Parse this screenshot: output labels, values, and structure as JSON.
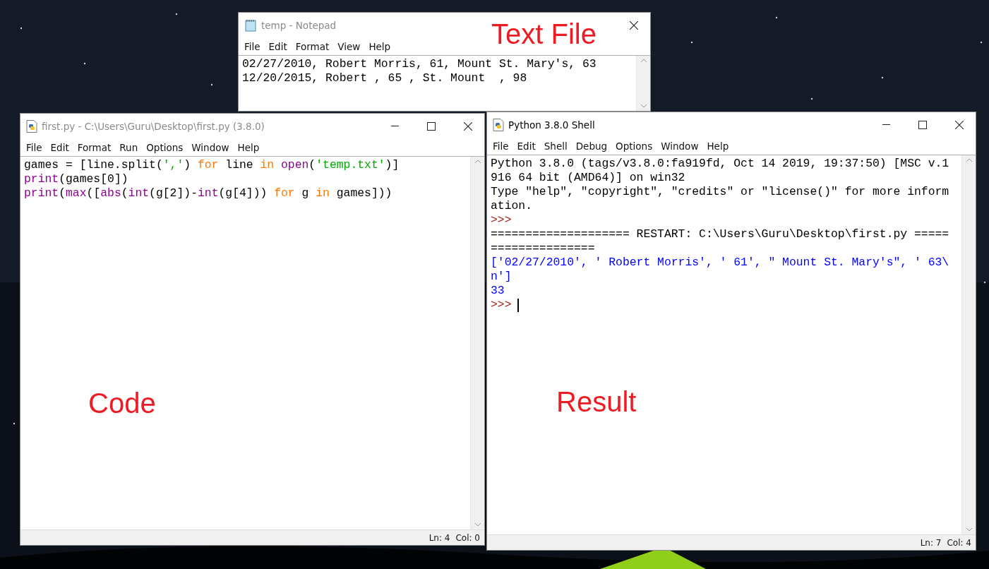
{
  "notepad": {
    "title": "temp - Notepad",
    "menu": [
      "File",
      "Edit",
      "Format",
      "View",
      "Help"
    ],
    "lines": [
      "02/27/2010, Robert Morris, 61, Mount St. Mary's, 63",
      "12/20/2015, Robert , 65 , St. Mount  , 98"
    ],
    "annotation": "Text File"
  },
  "editor": {
    "title": "first.py - C:\\Users\\Guru\\Desktop\\first.py (3.8.0)",
    "menu": [
      "File",
      "Edit",
      "Format",
      "Run",
      "Options",
      "Window",
      "Help"
    ],
    "lines": [
      [
        {
          "kind": "plain",
          "text": "games = [line.split("
        },
        {
          "kind": "string",
          "text": "','"
        },
        {
          "kind": "plain",
          "text": ") "
        },
        {
          "kind": "keyword",
          "text": "for"
        },
        {
          "kind": "plain",
          "text": " line "
        },
        {
          "kind": "keyword",
          "text": "in "
        },
        {
          "kind": "builtin",
          "text": "open"
        },
        {
          "kind": "plain",
          "text": "("
        },
        {
          "kind": "string",
          "text": "'temp.txt'"
        },
        {
          "kind": "plain",
          "text": ")]"
        }
      ],
      [
        {
          "kind": "builtin",
          "text": "print"
        },
        {
          "kind": "plain",
          "text": "(games[0])"
        }
      ],
      [
        {
          "kind": "builtin",
          "text": "print"
        },
        {
          "kind": "plain",
          "text": "("
        },
        {
          "kind": "builtin",
          "text": "max"
        },
        {
          "kind": "plain",
          "text": "(["
        },
        {
          "kind": "builtin",
          "text": "abs"
        },
        {
          "kind": "plain",
          "text": "("
        },
        {
          "kind": "builtin",
          "text": "int"
        },
        {
          "kind": "plain",
          "text": "(g[2])-"
        },
        {
          "kind": "builtin",
          "text": "int"
        },
        {
          "kind": "plain",
          "text": "(g[4])) "
        },
        {
          "kind": "keyword",
          "text": "for"
        },
        {
          "kind": "plain",
          "text": " g "
        },
        {
          "kind": "keyword",
          "text": "in"
        },
        {
          "kind": "plain",
          "text": " games]))"
        }
      ]
    ],
    "status": {
      "line": "Ln: 4",
      "col": "Col: 0"
    },
    "annotation": "Code"
  },
  "shell": {
    "title": "Python 3.8.0 Shell",
    "menu": [
      "File",
      "Edit",
      "Shell",
      "Debug",
      "Options",
      "Window",
      "Help"
    ],
    "lines": [
      {
        "kind": "plain",
        "text": "Python 3.8.0 (tags/v3.8.0:fa919fd, Oct 14 2019, 19:37:50) [MSC v.1"
      },
      {
        "kind": "plain",
        "text": "916 64 bit (AMD64)] on win32"
      },
      {
        "kind": "plain",
        "text": "Type \"help\", \"copyright\", \"credits\" or \"license()\" for more inform"
      },
      {
        "kind": "plain",
        "text": "ation."
      },
      {
        "kind": "prompt",
        "text": ">>>",
        "cursor": false
      },
      {
        "kind": "plain",
        "text": "==================== RESTART: C:\\Users\\Guru\\Desktop\\first.py ====="
      },
      {
        "kind": "plain",
        "text": "==============="
      },
      {
        "kind": "output",
        "text": "['02/27/2010', ' Robert Morris', ' 61', \" Mount St. Mary's\", ' 63\\"
      },
      {
        "kind": "output",
        "text": "n']"
      },
      {
        "kind": "output",
        "text": "33"
      },
      {
        "kind": "prompt",
        "text": ">>>",
        "cursor": true
      }
    ],
    "status": {
      "line": "Ln: 7",
      "col": "Col: 4"
    },
    "annotation": "Result"
  }
}
